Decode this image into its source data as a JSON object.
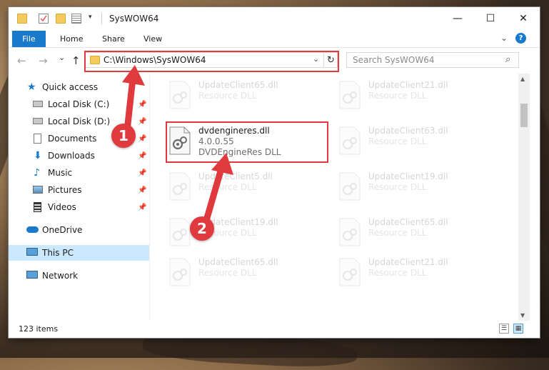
{
  "window": {
    "title": "SysWOW64",
    "minimize_glyph": "—",
    "maximize_glyph": "☐",
    "close_glyph": "✕"
  },
  "ribbon": {
    "file_label": "File",
    "tabs": [
      "Home",
      "Share",
      "View"
    ],
    "collapse_glyph": "⌄",
    "help_glyph": "?"
  },
  "navigation": {
    "back_glyph": "←",
    "forward_glyph": "→",
    "recent_glyph": "⌄",
    "up_glyph": "↑"
  },
  "address": {
    "path": "C:\\Windows\\SysWOW64",
    "dropdown_glyph": "⌄",
    "refresh_glyph": "↻"
  },
  "search": {
    "placeholder": "Search SysWOW64",
    "icon_glyph": "⌕"
  },
  "sidebar": {
    "items": [
      {
        "label": "Quick access",
        "icon": "star-icon"
      },
      {
        "label": "Local Disk (C:)",
        "icon": "drive-icon",
        "pin": "📌"
      },
      {
        "label": "Local Disk (D:)",
        "icon": "drive-icon",
        "pin": "📌"
      },
      {
        "label": "Documents",
        "icon": "documents-icon",
        "pin": "📌"
      },
      {
        "label": "Downloads",
        "icon": "downloads-icon",
        "pin": "📌"
      },
      {
        "label": "Music",
        "icon": "music-icon",
        "pin": "📌"
      },
      {
        "label": "Pictures",
        "icon": "pictures-icon",
        "pin": "📌"
      },
      {
        "label": "Videos",
        "icon": "videos-icon",
        "pin": "📌"
      },
      {
        "label": "OneDrive",
        "icon": "cloud-icon"
      },
      {
        "label": "This PC",
        "icon": "computer-icon",
        "selected": true
      },
      {
        "label": "Network",
        "icon": "network-icon"
      }
    ]
  },
  "files": {
    "highlighted": {
      "name": "dvdengineres.dll",
      "version": "4.0.0.55",
      "description": "DVDEngineRes DLL"
    },
    "faded": [
      {
        "name": "UpdateClient65.dll",
        "description": "Resource DLL"
      },
      {
        "name": "UpdateClient21.dll",
        "description": "Resource DLL"
      },
      {
        "name": "UpdateClient63.dll",
        "description": "Resource DLL"
      },
      {
        "name": "UpdateClient5.dll",
        "description": "Resource DLL"
      },
      {
        "name": "UpdateClient19.dll",
        "description": "Resource DLL"
      },
      {
        "name": "UpdateClient19.dll",
        "description": "Resource DLL"
      },
      {
        "name": "UpdateClient65.dll",
        "description": "Resource DLL"
      },
      {
        "name": "UpdateClient65.dll",
        "description": "Resource DLL"
      },
      {
        "name": "UpdateClient21.dll",
        "description": "Resource DLL"
      }
    ]
  },
  "status": {
    "item_count": "123 items",
    "details_view_glyph": "☰",
    "tiles_view_glyph": "▦"
  },
  "annotations": {
    "step1": "1",
    "step2": "2",
    "highlight_color": "#e0393e"
  },
  "colors": {
    "accent": "#1979ca",
    "selection": "#cce8ff",
    "folder": "#f4c95d"
  }
}
